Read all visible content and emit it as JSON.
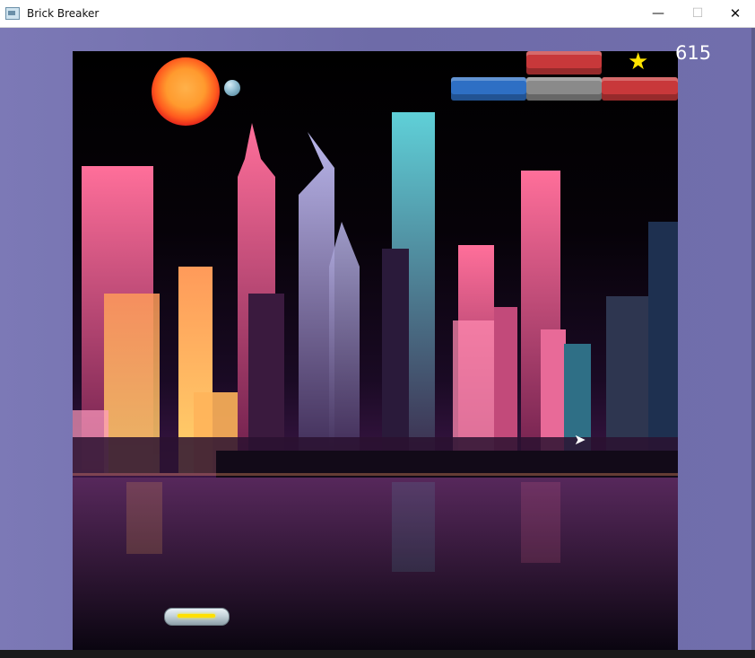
{
  "window": {
    "title": "Brick Breaker",
    "minimize_glyph": "—",
    "maximize_glyph": "☐",
    "close_glyph": "✕"
  },
  "hud": {
    "score": "615",
    "star_icon": "star-icon",
    "star_glyph": "★"
  },
  "bricks": {
    "colors": [
      "red",
      "blue",
      "gray",
      "red"
    ]
  },
  "colors": {
    "brick_red": "#c8383a",
    "brick_blue": "#2e6fc4",
    "brick_gray": "#8a8a8a",
    "paddle_accent": "#ffe000",
    "star": "#ffe400"
  }
}
